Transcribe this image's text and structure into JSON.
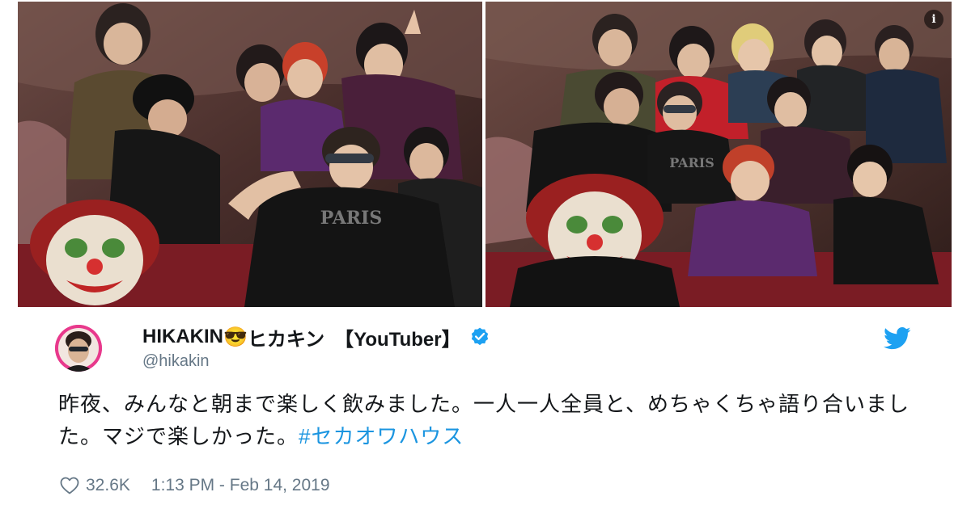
{
  "tweet": {
    "author": {
      "display_name_pre": "HIKAKIN",
      "emoji": "😎",
      "display_name_post": "ヒカキン　【YouTuber】",
      "handle": "@hikakin",
      "verified": true
    },
    "text": "昨夜、みんなと朝まで楽しく飲みました。一人一人全員と、めちゃくちゃ語り合いました。マジで楽しかった。",
    "hashtag": "#セカオワハウス",
    "likes": "32.6K",
    "timestamp": "1:13 PM - Feb 14, 2019"
  },
  "media": {
    "info_button_glyph": "i",
    "photos": [
      {
        "id": "photo-left",
        "alt": "group photo"
      },
      {
        "id": "photo-right",
        "alt": "group photo"
      }
    ]
  },
  "icons": {
    "verified": "verified-badge-icon",
    "bird": "twitter-bird-icon",
    "heart": "heart-outline-icon",
    "info": "info-icon"
  },
  "colors": {
    "text": "#14171a",
    "secondary": "#657786",
    "link": "#1b95e0",
    "verified": "#1da1f2",
    "bird": "#1da1f2",
    "avatar_ring": "#e8398c"
  }
}
